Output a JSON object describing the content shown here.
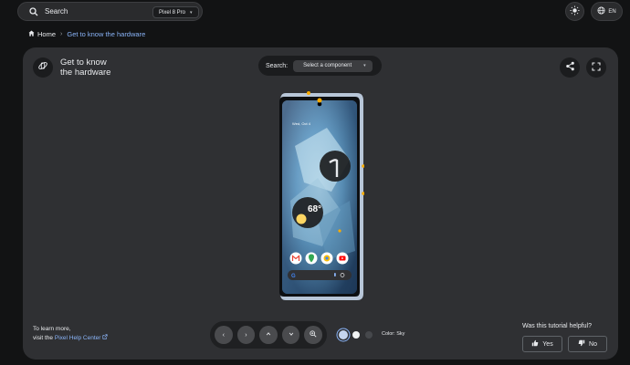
{
  "header": {
    "search_label": "Search",
    "device_selector": "Pixel 8 Pro",
    "language": "EN"
  },
  "breadcrumb": {
    "home": "Home",
    "current": "Get to know the hardware"
  },
  "card": {
    "title_line1": "Get to know",
    "title_line2": "the hardware",
    "component_search_label": "Search:",
    "component_select": "Select a component"
  },
  "phone_screen": {
    "temperature": "68°"
  },
  "footer": {
    "learn_more": "To learn more,",
    "visit": "visit the",
    "help_link": "Pixel Help Center",
    "color_label": "Color: Sky",
    "helpful_question": "Was this tutorial helpful?",
    "yes": "Yes",
    "no": "No"
  },
  "colors": {
    "accent": "#8ab4f8",
    "card_bg": "#2f3033",
    "page_bg": "#121314",
    "swatches": [
      "#c5d5ee",
      "#f1f3f4",
      "#46484c"
    ]
  },
  "icons": [
    "search-icon",
    "chevron-down-icon",
    "sun-icon",
    "globe-icon",
    "home-icon",
    "rotate-3d-icon",
    "share-icon",
    "fullscreen-icon",
    "chevron-left-icon",
    "chevron-right-icon",
    "chevron-up-icon",
    "zoom-icon",
    "external-link-icon",
    "thumb-up-icon",
    "thumb-down-icon"
  ]
}
